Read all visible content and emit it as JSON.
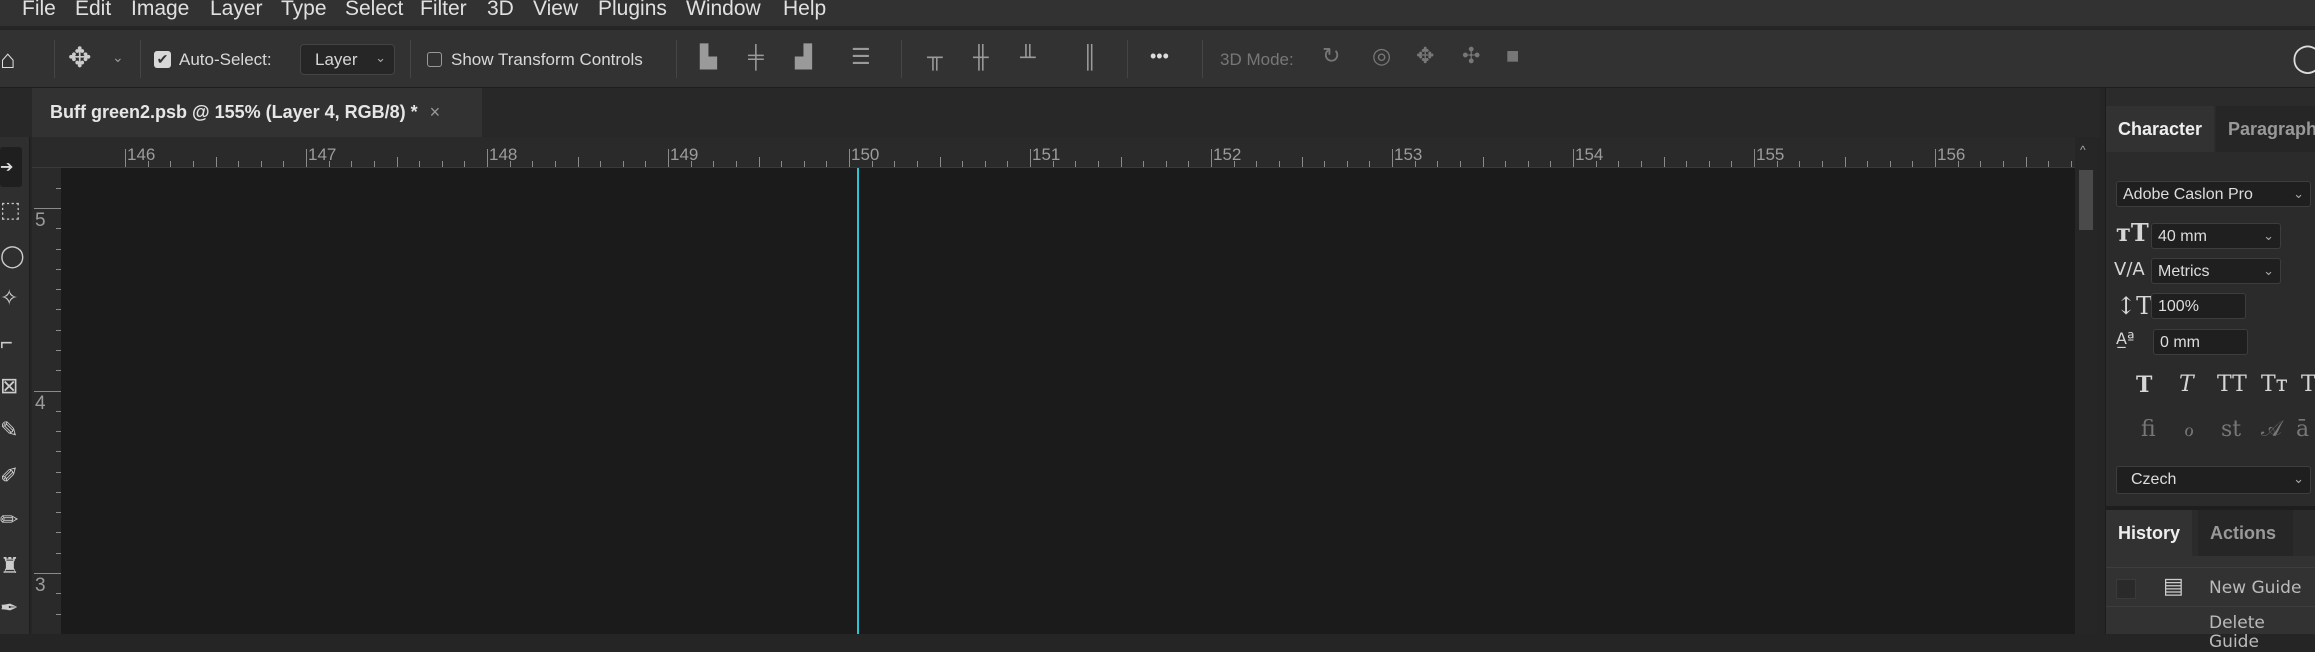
{
  "menu": [
    "File",
    "Edit",
    "Image",
    "Layer",
    "Type",
    "Select",
    "Filter",
    "3D",
    "View",
    "Plugins",
    "Window",
    "Help"
  ],
  "options": {
    "auto_select_label": "Auto-Select:",
    "auto_select_checked": true,
    "layer_select": "Layer",
    "show_transform_label": "Show Transform Controls",
    "show_transform_checked": false,
    "more": "•••",
    "mode_3d_label": "3D Mode:"
  },
  "document": {
    "tab_title": "Buff green2.psb @ 155% (Layer 4, RGB/8) *",
    "close": "×"
  },
  "rulers": {
    "horizontal": [
      "146",
      "147",
      "148",
      "149",
      "150",
      "151",
      "152",
      "153",
      "154",
      "155",
      "156"
    ],
    "vertical": [
      "5",
      "4",
      "3"
    ]
  },
  "guide_color": "#2ec4d6",
  "character_panel": {
    "tabs": [
      "Character",
      "Paragraph"
    ],
    "font": "Adobe Caslon Pro",
    "size": "40 mm",
    "kerning": "Metrics",
    "vertical_scale": "100%",
    "baseline_shift": "0 mm",
    "style_buttons": [
      "T",
      "T",
      "TT",
      "Tт",
      "T"
    ],
    "opentype_buttons": [
      "ﬁ",
      "ℴ",
      "st",
      "𝒜",
      "ā"
    ],
    "language": "Czech"
  },
  "history_panel": {
    "tabs": [
      "History",
      "Actions"
    ],
    "items": [
      "",
      "New Guide",
      "Delete Guide"
    ]
  }
}
